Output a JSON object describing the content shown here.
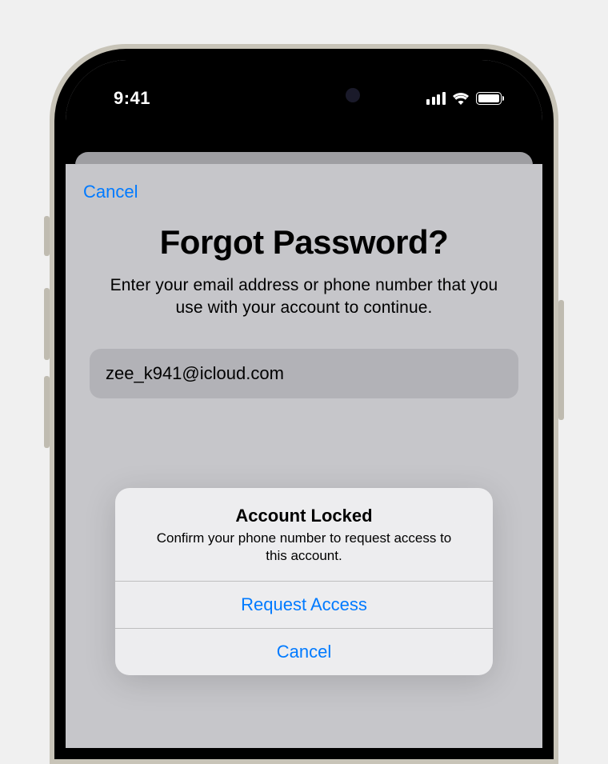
{
  "status": {
    "time": "9:41"
  },
  "nav": {
    "cancel": "Cancel"
  },
  "page": {
    "heading": "Forgot Password?",
    "subtext": "Enter your email address or phone number that you use with your account to continue.",
    "email_value": "zee_k941@icloud.com"
  },
  "alert": {
    "title": "Account Locked",
    "message": "Confirm your phone number to request access to this account.",
    "primary_action": "Request Access",
    "cancel_action": "Cancel"
  }
}
